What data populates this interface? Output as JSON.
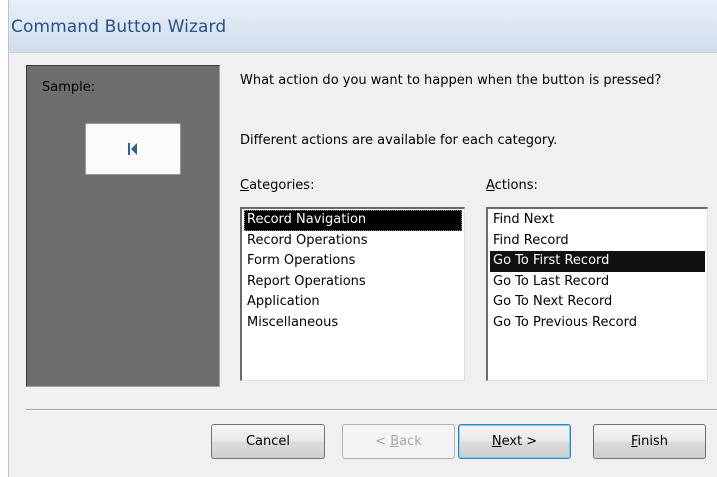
{
  "window": {
    "title": "Command Button Wizard"
  },
  "sample": {
    "label": "Sample:",
    "button_icon": "go-to-first-record-icon"
  },
  "prompt": {
    "question": "What action do you want to happen when the button is pressed?",
    "info": "Different actions are available for each category."
  },
  "categories": {
    "label_first": "C",
    "label_rest": "ategories:",
    "items": [
      "Record Navigation",
      "Record Operations",
      "Form Operations",
      "Report Operations",
      "Application",
      "Miscellaneous"
    ],
    "selected": "Record Navigation"
  },
  "actions": {
    "label_first": "A",
    "label_rest": "ctions:",
    "items": [
      "Find Next",
      "Find Record",
      "Go To First Record",
      "Go To Last Record",
      "Go To Next Record",
      "Go To Previous Record"
    ],
    "selected": "Go To First Record"
  },
  "buttons": {
    "cancel": "Cancel",
    "back_prefix": "< ",
    "back_mnemonic": "B",
    "back_rest": "ack",
    "next_mnemonic": "N",
    "next_rest": "ext >",
    "finish_mnemonic": "F",
    "finish_rest": "inish"
  },
  "colors": {
    "title_text": "#2a4f83",
    "sample_panel": "#6e6e6e",
    "selection": "#000000",
    "default_button_focus": "#6fd4f5"
  }
}
